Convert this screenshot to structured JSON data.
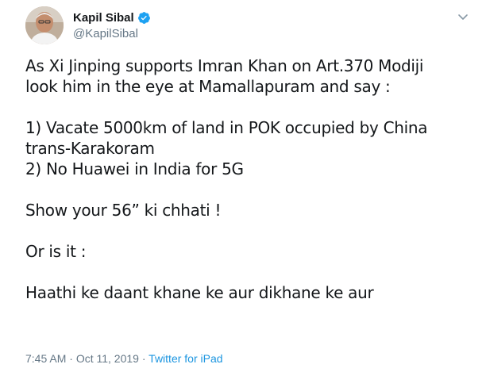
{
  "author": {
    "display_name": "Kapil Sibal",
    "handle": "@KapilSibal",
    "verified": true
  },
  "tweet": {
    "lines": [
      "As Xi Jinping supports Imran Khan on Art.370 Modiji",
      "look him in the eye at Mamallapuram and say :",
      "",
      "1) Vacate 5000km of land in POK occupied by China",
      "trans-Karakoram",
      "2) No Huawei in India for 5G",
      "",
      "Show your 56” ki chhati !",
      "",
      "Or is it :",
      "",
      "Haathi ke daant khane ke aur dikhane ke aur"
    ]
  },
  "meta": {
    "time": "7:45 AM",
    "separator1": " · ",
    "date": "Oct 11, 2019",
    "separator2": " · ",
    "source": "Twitter for iPad"
  },
  "icons": {
    "verified": "verified-badge-icon",
    "menu": "chevron-down-icon"
  },
  "colors": {
    "link": "#1b95e0",
    "secondary_text": "#657786",
    "verified": "#1da1f2"
  }
}
